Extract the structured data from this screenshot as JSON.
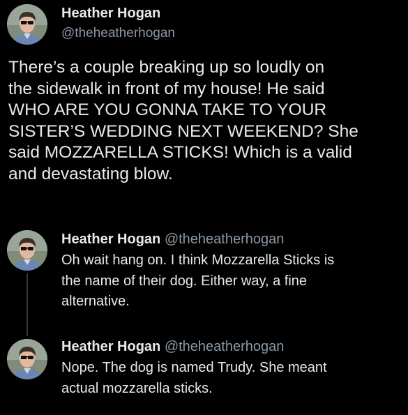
{
  "main_tweet": {
    "author_name": "Heather Hogan",
    "author_handle": "@theheatherhogan",
    "text_lines": [
      "There’s a couple breaking up so loudly on",
      "the sidewalk in front of my house! He said",
      "WHO ARE YOU GONNA TAKE TO YOUR",
      "SISTER’S WEDDING NEXT WEEKEND? She",
      "said MOZZARELLA STICKS! Which is a valid",
      "and devastating blow."
    ]
  },
  "replies": [
    {
      "author_name": "Heather Hogan",
      "author_handle": "@theheatherhogan",
      "text_lines": [
        "Oh wait hang on. I think Mozzarella Sticks is",
        "the name of their dog. Either way, a fine",
        "alternative."
      ]
    },
    {
      "author_name": "Heather Hogan",
      "author_handle": "@theheatherhogan",
      "text_lines": [
        "Nope. The dog is named Trudy. She meant",
        "actual mozzarella sticks."
      ]
    }
  ],
  "colors": {
    "background": "#000000",
    "primary_text": "#e7e9ea",
    "secondary_text": "#8b98a5",
    "thread_line": "#333639"
  }
}
